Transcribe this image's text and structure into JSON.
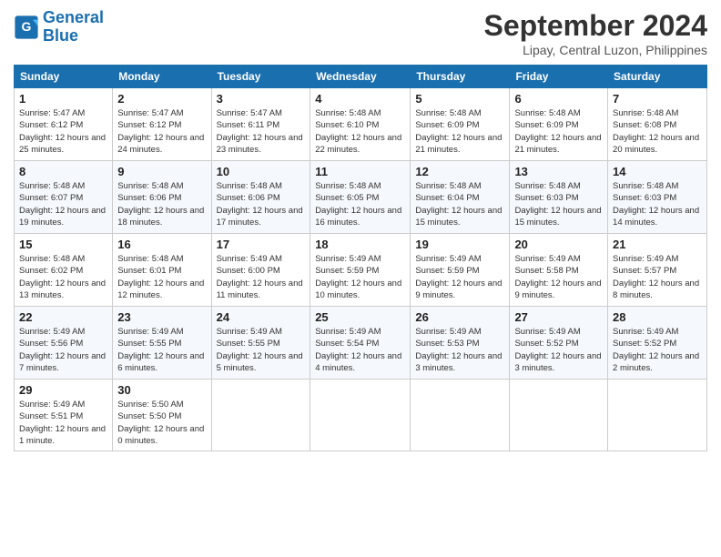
{
  "header": {
    "logo_line1": "General",
    "logo_line2": "Blue",
    "month_title": "September 2024",
    "subtitle": "Lipay, Central Luzon, Philippines"
  },
  "days_of_week": [
    "Sunday",
    "Monday",
    "Tuesday",
    "Wednesday",
    "Thursday",
    "Friday",
    "Saturday"
  ],
  "weeks": [
    [
      {
        "day": "1",
        "rise": "5:47 AM",
        "set": "6:12 PM",
        "daylight": "12 hours and 25 minutes."
      },
      {
        "day": "2",
        "rise": "5:47 AM",
        "set": "6:12 PM",
        "daylight": "12 hours and 24 minutes."
      },
      {
        "day": "3",
        "rise": "5:47 AM",
        "set": "6:11 PM",
        "daylight": "12 hours and 23 minutes."
      },
      {
        "day": "4",
        "rise": "5:48 AM",
        "set": "6:10 PM",
        "daylight": "12 hours and 22 minutes."
      },
      {
        "day": "5",
        "rise": "5:48 AM",
        "set": "6:09 PM",
        "daylight": "12 hours and 21 minutes."
      },
      {
        "day": "6",
        "rise": "5:48 AM",
        "set": "6:09 PM",
        "daylight": "12 hours and 21 minutes."
      },
      {
        "day": "7",
        "rise": "5:48 AM",
        "set": "6:08 PM",
        "daylight": "12 hours and 20 minutes."
      }
    ],
    [
      {
        "day": "8",
        "rise": "5:48 AM",
        "set": "6:07 PM",
        "daylight": "12 hours and 19 minutes."
      },
      {
        "day": "9",
        "rise": "5:48 AM",
        "set": "6:06 PM",
        "daylight": "12 hours and 18 minutes."
      },
      {
        "day": "10",
        "rise": "5:48 AM",
        "set": "6:06 PM",
        "daylight": "12 hours and 17 minutes."
      },
      {
        "day": "11",
        "rise": "5:48 AM",
        "set": "6:05 PM",
        "daylight": "12 hours and 16 minutes."
      },
      {
        "day": "12",
        "rise": "5:48 AM",
        "set": "6:04 PM",
        "daylight": "12 hours and 15 minutes."
      },
      {
        "day": "13",
        "rise": "5:48 AM",
        "set": "6:03 PM",
        "daylight": "12 hours and 15 minutes."
      },
      {
        "day": "14",
        "rise": "5:48 AM",
        "set": "6:03 PM",
        "daylight": "12 hours and 14 minutes."
      }
    ],
    [
      {
        "day": "15",
        "rise": "5:48 AM",
        "set": "6:02 PM",
        "daylight": "12 hours and 13 minutes."
      },
      {
        "day": "16",
        "rise": "5:48 AM",
        "set": "6:01 PM",
        "daylight": "12 hours and 12 minutes."
      },
      {
        "day": "17",
        "rise": "5:49 AM",
        "set": "6:00 PM",
        "daylight": "12 hours and 11 minutes."
      },
      {
        "day": "18",
        "rise": "5:49 AM",
        "set": "5:59 PM",
        "daylight": "12 hours and 10 minutes."
      },
      {
        "day": "19",
        "rise": "5:49 AM",
        "set": "5:59 PM",
        "daylight": "12 hours and 9 minutes."
      },
      {
        "day": "20",
        "rise": "5:49 AM",
        "set": "5:58 PM",
        "daylight": "12 hours and 9 minutes."
      },
      {
        "day": "21",
        "rise": "5:49 AM",
        "set": "5:57 PM",
        "daylight": "12 hours and 8 minutes."
      }
    ],
    [
      {
        "day": "22",
        "rise": "5:49 AM",
        "set": "5:56 PM",
        "daylight": "12 hours and 7 minutes."
      },
      {
        "day": "23",
        "rise": "5:49 AM",
        "set": "5:55 PM",
        "daylight": "12 hours and 6 minutes."
      },
      {
        "day": "24",
        "rise": "5:49 AM",
        "set": "5:55 PM",
        "daylight": "12 hours and 5 minutes."
      },
      {
        "day": "25",
        "rise": "5:49 AM",
        "set": "5:54 PM",
        "daylight": "12 hours and 4 minutes."
      },
      {
        "day": "26",
        "rise": "5:49 AM",
        "set": "5:53 PM",
        "daylight": "12 hours and 3 minutes."
      },
      {
        "day": "27",
        "rise": "5:49 AM",
        "set": "5:52 PM",
        "daylight": "12 hours and 3 minutes."
      },
      {
        "day": "28",
        "rise": "5:49 AM",
        "set": "5:52 PM",
        "daylight": "12 hours and 2 minutes."
      }
    ],
    [
      {
        "day": "29",
        "rise": "5:49 AM",
        "set": "5:51 PM",
        "daylight": "12 hours and 1 minute."
      },
      {
        "day": "30",
        "rise": "5:50 AM",
        "set": "5:50 PM",
        "daylight": "12 hours and 0 minutes."
      },
      null,
      null,
      null,
      null,
      null
    ]
  ],
  "labels": {
    "sunrise": "Sunrise:",
    "sunset": "Sunset:",
    "daylight": "Daylight:"
  }
}
